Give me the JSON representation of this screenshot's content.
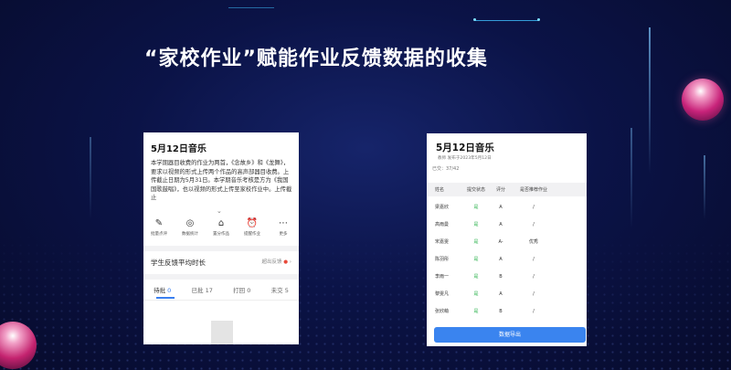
{
  "slide": {
    "title": "“家校作业”赋能作业反馈数据的收集"
  },
  "colors": {
    "background": "#0b1347",
    "accent_blue": "#3a84ef",
    "status_green": "#2bb24c",
    "highlight_red": "#e84a3a"
  },
  "phone_left": {
    "title": "5月12日音乐",
    "description": "本学期器目收费的作业为两首，《念故乡》和《龙舞》，要求以视频的形式上传两个作品的高声部器目收费。上传截止日期为5月31日。本学期音乐考核是方为《我国国歌鼓唱》，也以视频的形式上传至家校作业中。上传截止",
    "expand_icon": "chevron-down-icon",
    "actions": [
      {
        "icon": "pencil-icon",
        "glyph": "✎",
        "label": "批量点评"
      },
      {
        "icon": "data-icon",
        "glyph": "◎",
        "label": "数据统计"
      },
      {
        "icon": "folder-icon",
        "glyph": "⌂",
        "label": "置分作品"
      },
      {
        "icon": "alarm-icon",
        "glyph": "⏰",
        "label": "提醒作业"
      },
      {
        "icon": "more-icon",
        "glyph": "⋯",
        "label": "更多"
      }
    ],
    "stat_label": "学生反馈平均时长",
    "stat_right": "超出反馈",
    "tabs": [
      {
        "label": "待批",
        "count": "0"
      },
      {
        "label": "已批",
        "count": "17"
      },
      {
        "label": "打回",
        "count": "0"
      },
      {
        "label": "未交",
        "count": "5"
      }
    ]
  },
  "phone_right": {
    "title": "5月12日音乐",
    "meta": "教师 发布于2023年5月12日",
    "count": "已交：37/42",
    "headers": [
      "姓名",
      "提交状态",
      "评分",
      "是否推荐作业"
    ],
    "rows": [
      {
        "name": "梁嘉欣",
        "status": "是",
        "grade": "A",
        "recommend": "/"
      },
      {
        "name": "高雨曼",
        "status": "是",
        "grade": "A",
        "recommend": "/"
      },
      {
        "name": "宋嘉雯",
        "status": "是",
        "grade": "A-",
        "recommend": "优秀"
      },
      {
        "name": "陈羽彤",
        "status": "是",
        "grade": "A",
        "recommend": "/"
      },
      {
        "name": "李雨一",
        "status": "是",
        "grade": "B",
        "recommend": "/"
      },
      {
        "name": "黎雯凡",
        "status": "是",
        "grade": "A",
        "recommend": "/"
      },
      {
        "name": "张欣萌",
        "status": "是",
        "grade": "B",
        "recommend": "/"
      }
    ],
    "export_button": "数据导出"
  }
}
